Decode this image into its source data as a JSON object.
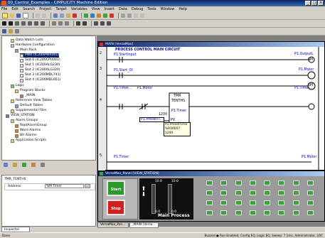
{
  "app": {
    "title": "00_Control_Examples - CIMPLICITY Machine Edition"
  },
  "menu": [
    "File",
    "Edit",
    "Search",
    "Project",
    "Target",
    "Variables",
    "View",
    "Insert",
    "Data",
    "Debug",
    "Tools",
    "Window",
    "Help"
  ],
  "tree": {
    "items": [
      {
        "label": "Data Watch Lists",
        "level": 2
      },
      {
        "label": "Hardware Configuration",
        "level": 2
      },
      {
        "label": "Main Rack",
        "level": 3
      },
      {
        "label": "PWR (IC200PWR001)",
        "level": 4,
        "selected": true
      },
      {
        "label": "Slot 0 (IC200CPU001)",
        "level": 4
      },
      {
        "label": "Slot 1 (IC200ALG230)",
        "level": 4
      },
      {
        "label": "Slot 2 (IC200ALG320)",
        "level": 4
      },
      {
        "label": "Slot 3 (IC200MDL741)",
        "level": 4
      },
      {
        "label": "Slot 4 (IC200MDL651)",
        "level": 4
      },
      {
        "label": "Logic",
        "level": 2
      },
      {
        "label": "Program Blocks",
        "level": 3
      },
      {
        "label": "_MAIN",
        "level": 4
      },
      {
        "label": "Reference View Tables",
        "level": 2
      },
      {
        "label": "Default Tables",
        "level": 3
      },
      {
        "label": "Supplemental Files",
        "level": 2
      },
      {
        "label": "VIEW_STATION",
        "level": 1
      },
      {
        "label": "Alarm Groups",
        "level": 2
      },
      {
        "label": "RootAlarmGroup",
        "level": 3
      },
      {
        "label": "Word Alarms",
        "level": 3
      },
      {
        "label": "Bit Alarms",
        "level": 3
      },
      {
        "label": "Application Scripts",
        "level": 2
      }
    ]
  },
  "inspector": {
    "object": "TMR_TENTHS",
    "address_label": "Address",
    "address_value": "%M Timer",
    "tab": "Inspector"
  },
  "ladder": {
    "window_title": "MAIN [VersaMax]",
    "rung_numbers": [
      "2",
      "3",
      "4",
      "5"
    ],
    "comment": "PROCESS CONTROL MAIN CIRCUIT",
    "contacts": [
      "P1.StartInput",
      "P1.Start_OI",
      "P1.Timer...",
      "P1.Motor",
      "P1.Timer"
    ],
    "coils": [
      "P1.OutputL",
      "P1.Motor",
      "P1.Timer...",
      "P1.Motor"
    ],
    "coil_symbols": [
      "SM",
      "SM"
    ],
    "timer_block": {
      "title": "TMR",
      "sub": "TENTHS",
      "value": "1200",
      "pv": "PV",
      "tag": "P1.Timer",
      "preset_tag": "P1.PresetTi..."
    },
    "tooltip": [
      "P1.PresetTime",
      "%R00007",
      "1200"
    ]
  },
  "panel": {
    "window_title": "VersaMax_Panel [VIEW_STATION]",
    "start_label": "Start",
    "stop_label": "Stop",
    "gauge_left": "10.0",
    "gauge_right": "10.0",
    "gauge_left_bottom": "0.0",
    "gauge_right_bottom": "0.0",
    "caption": "Main Process"
  },
  "doc_tabs": [
    "VersaMax_Pan...",
    "_MAIN [Versa..."
  ],
  "status": {
    "text": "Done",
    "right": "Buzzed ● Run Enabled, Config EQ, Logic EQ, Sweep: 7.1ms, Administrator, LOC"
  },
  "colors": {
    "start": "#2a9a2a",
    "stop": "#d02020",
    "title": "#0a246a",
    "led": "#40a040"
  }
}
